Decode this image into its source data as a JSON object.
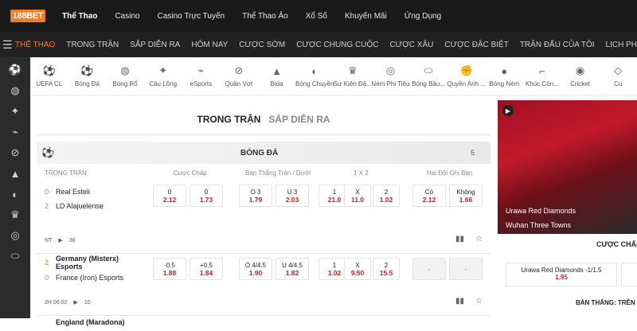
{
  "brand": {
    "logo_text": "188BET"
  },
  "topnav": [
    "Thể Thao",
    "Casino",
    "Casino Trực Tuyến",
    "Thể Thao Ảo",
    "Xổ Số",
    "Khuyến Mãi",
    "Ứng Dụng"
  ],
  "subnav": [
    "THỂ THAO",
    "TRONG TRẬN",
    "SẮP DIỄN RA",
    "HÔM NAY",
    "CƯỢC SỚM",
    "CƯỢC CHUNG CUỘC",
    "CƯỢC XÂU",
    "CƯỢC ĐẶC BIỆT",
    "TRẬN ĐẤU CỦA TÔI",
    "LỊCH PH"
  ],
  "sports": [
    {
      "label": "UEFA CL",
      "icon": "ball-icon"
    },
    {
      "label": "Bóng Đá",
      "icon": "soccer-icon"
    },
    {
      "label": "Bóng Rổ",
      "icon": "basketball-icon"
    },
    {
      "label": "Cầu Lông",
      "icon": "shuttlecock-icon"
    },
    {
      "label": "eSports",
      "icon": "esports-icon"
    },
    {
      "label": "Quần Vợt",
      "icon": "tennis-icon"
    },
    {
      "label": "Bida",
      "icon": "billiards-icon"
    },
    {
      "label": "Bóng Chuyền",
      "icon": "volleyball-icon"
    },
    {
      "label": "Sự Kiện Đặ...",
      "icon": "trophy-icon"
    },
    {
      "label": "Ném Phi Tiêu",
      "icon": "darts-icon"
    },
    {
      "label": "Bóng Bầu...",
      "icon": "rugby-icon"
    },
    {
      "label": "Quyền Anh ...",
      "icon": "boxing-icon"
    },
    {
      "label": "Bóng Ném",
      "icon": "handball-icon"
    },
    {
      "label": "Khúc Côn...",
      "icon": "hockey-icon"
    },
    {
      "label": "Cricket",
      "icon": "cricket-icon"
    },
    {
      "label": "Cu",
      "icon": "misc-icon"
    }
  ],
  "tabs": {
    "live": "TRONG TRẬN",
    "upcoming": "SẮP DIỄN RA"
  },
  "league": {
    "name": "BÓNG ĐÁ",
    "count": "5"
  },
  "columns": {
    "status": "TRONG TRẬN",
    "handicap": "Cược Chấp",
    "overunder": "Bàn Thắng Trên / Dưới",
    "x12": "1 X 2",
    "btts": "Hai Đội Ghi Bàn"
  },
  "matches": [
    {
      "home": "Real Esteli",
      "home_score": "0",
      "away": "LD Alajuelense",
      "away_score": "2",
      "handicap": [
        {
          "l": "0",
          "v": "2.12"
        },
        {
          "l": "0",
          "v": "1.73"
        }
      ],
      "overunder": [
        {
          "l": "O 3",
          "v": "1.79"
        },
        {
          "l": "U 3",
          "v": "2.03"
        }
      ],
      "x12": [
        {
          "l": "1",
          "v": "21.0"
        },
        {
          "l": "X",
          "v": "11.0"
        },
        {
          "l": "2",
          "v": "1.02"
        }
      ],
      "btts": [
        {
          "l": "Có",
          "v": "2.12"
        },
        {
          "l": "Không",
          "v": "1.66"
        }
      ],
      "time": "NT",
      "markets": "36"
    },
    {
      "home": "Germany (Misterx) Esports",
      "home_score": "2",
      "away": "France (Iron) Esports",
      "away_score": "0",
      "handicap": [
        {
          "l": "-0.5",
          "v": "1.88"
        },
        {
          "l": "+0.5",
          "v": "1.84"
        }
      ],
      "overunder": [
        {
          "l": "O 4/4.5",
          "v": "1.90"
        },
        {
          "l": "U 4/4.5",
          "v": "1.82"
        }
      ],
      "x12": [
        {
          "l": "1",
          "v": "1.02"
        },
        {
          "l": "X",
          "v": "9.50"
        },
        {
          "l": "2",
          "v": "15.5"
        }
      ],
      "btts": [
        {
          "l": "-",
          "v": ""
        },
        {
          "l": "-",
          "v": ""
        }
      ],
      "time": "2H 06:02",
      "markets": "10"
    },
    {
      "home": "England (Maradona)"
    }
  ],
  "right": {
    "team1": "Urawa Red Diamonds",
    "team2": "Wuhan Three Towns",
    "section1": "CƯỢC CHẤP",
    "odd_label": "Urawa Red Diamonds -1/1.5",
    "odd_value": "1.95",
    "section2": "BÀN THẮNG: TRÊN"
  },
  "colors": {
    "accent": "#f47b20",
    "odds": "#d6181f",
    "topbar": "#1a1a1a"
  }
}
